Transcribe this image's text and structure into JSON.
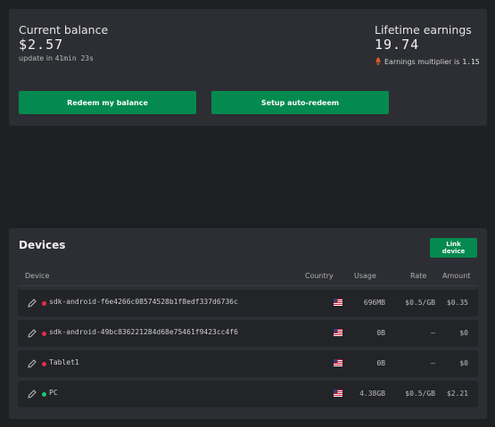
{
  "balance": {
    "label": "Current balance",
    "value": "$2.57",
    "update_prefix": "update in ",
    "update_time": "41min 23s"
  },
  "lifetime": {
    "label": "Lifetime earnings",
    "value": "19.74",
    "multiplier_label": "Earnings multiplier is",
    "multiplier_value": "1.15"
  },
  "actions": {
    "redeem_label": "Redeem my balance",
    "auto_label": "Setup auto-redeem"
  },
  "devices": {
    "title": "Devices",
    "link_label": "Link device",
    "columns": {
      "device": "Device",
      "country": "Country",
      "usage": "Usage",
      "rate": "Rate",
      "amount": "Amount"
    },
    "rows": [
      {
        "name": "sdk-android-f6e4266c08574528b1f8edf337d6736c",
        "status": "offline",
        "country": "us-flag",
        "usage": "696MB",
        "rate": "$0.5/GB",
        "amount": "$0.35"
      },
      {
        "name": "sdk-android-49bc836221284d68e75461f9423cc4f6",
        "status": "offline",
        "country": "us-flag",
        "usage": "0B",
        "rate": "—",
        "amount": "$0"
      },
      {
        "name": "Tablet1",
        "status": "offline",
        "country": "us-flag",
        "usage": "0B",
        "rate": "—",
        "amount": "$0"
      },
      {
        "name": "PC",
        "status": "online",
        "country": "us-flag",
        "usage": "4.38GB",
        "rate": "$0.5/GB",
        "amount": "$2.21"
      }
    ]
  },
  "colors": {
    "accent": "#048a4f",
    "online": "#1ec87a",
    "offline": "#e0304a"
  }
}
